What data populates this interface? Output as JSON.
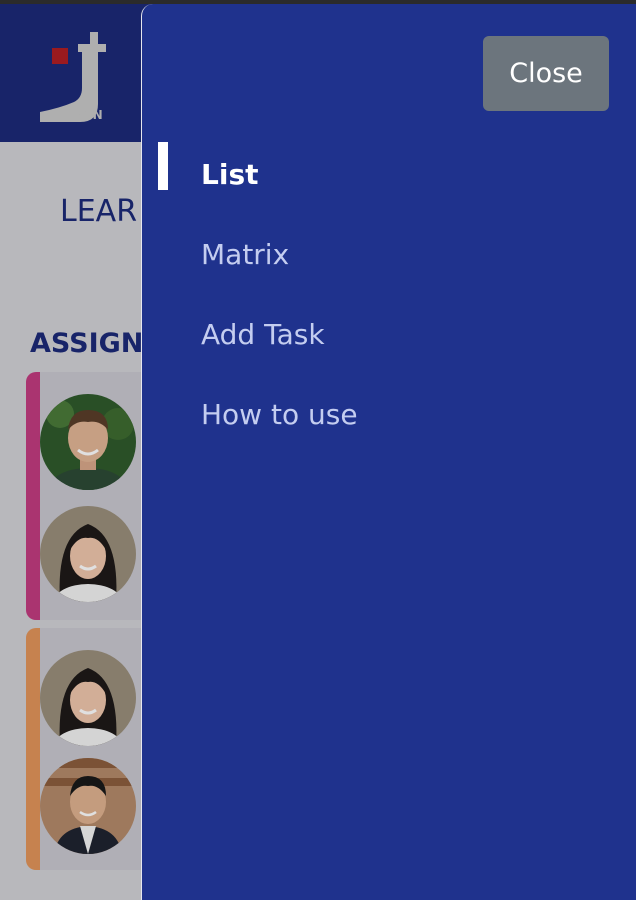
{
  "background_page": {
    "logo_suffix": "OIN",
    "section_learn": "LEAR",
    "section_assigned": "ASSIGNI",
    "cards": [
      {
        "stripe_color": "#c23c80",
        "avatars": [
          "avatar-man-green-background",
          "avatar-woman-dark-hair"
        ]
      },
      {
        "stripe_color": "#e2955a",
        "avatars": [
          "avatar-woman-dark-hair",
          "avatar-man-suit"
        ]
      }
    ]
  },
  "drawer": {
    "close_label": "Close",
    "menu": [
      {
        "label": "List",
        "active": true
      },
      {
        "label": "Matrix",
        "active": false
      },
      {
        "label": "Add Task",
        "active": false
      },
      {
        "label": "How to use",
        "active": false
      }
    ]
  },
  "colors": {
    "drawer_bg": "#1f328d",
    "header_bg": "#1c2a78",
    "close_button_bg": "#6c757d",
    "active_indicator": "#ffffff"
  }
}
